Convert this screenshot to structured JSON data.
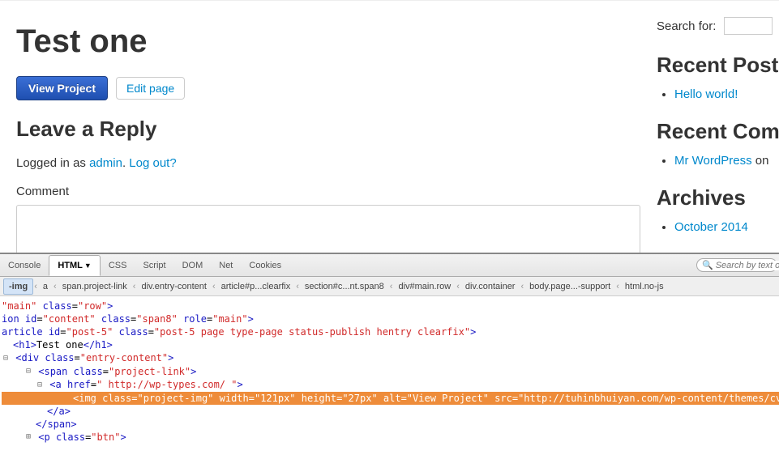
{
  "main": {
    "title": "Test one",
    "view_btn": "View Project",
    "edit_btn": "Edit page",
    "reply_heading": "Leave a Reply",
    "logged_prefix": "Logged in as ",
    "logged_user": "admin",
    "logged_sep": ". ",
    "logout": "Log out?",
    "comment_label": "Comment"
  },
  "sidebar": {
    "search_label": "Search for:",
    "recent_posts_h": "Recent Posts",
    "recent_post_0": "Hello world!",
    "recent_comments_h": "Recent Comments",
    "recent_comment_author": "Mr WordPress",
    "recent_comment_on": " on ",
    "archives_h": "Archives",
    "archive_0": "October 2014"
  },
  "devtools": {
    "tabs": {
      "console": "Console",
      "html": "HTML",
      "css": "CSS",
      "script": "Script",
      "dom": "DOM",
      "net": "Net",
      "cookies": "Cookies"
    },
    "search_placeholder": "Search by text or",
    "crumbs": [
      "-img",
      "a",
      "span.project-link",
      "div.entry-content",
      "article#p...clearfix",
      "section#c...nt.span8",
      "div#main.row",
      "div.container",
      "body.page...-support",
      "html.no-js"
    ],
    "code": {
      "l0_attr": "main",
      "l0_class": "row",
      "l1_id": "content",
      "l1_class": "span8",
      "l1_role": "main",
      "l2_id": "post-5",
      "l2_class": "post-5 page type-page status-publish hentry clearfix",
      "l3_text": "Test one",
      "l4_class": "entry-content",
      "l5_class": "project-link",
      "l6_href": " http://wp-types.com/ ",
      "l7_full": "<img class=\"project-img\" width=\"121px\" height=\"27px\" alt=\"View Project\" src=\"http://tuhinbhuiyan.com/wp-content/themes/cv/images/pr_btn.png\">",
      "l10_class": "btn"
    }
  }
}
